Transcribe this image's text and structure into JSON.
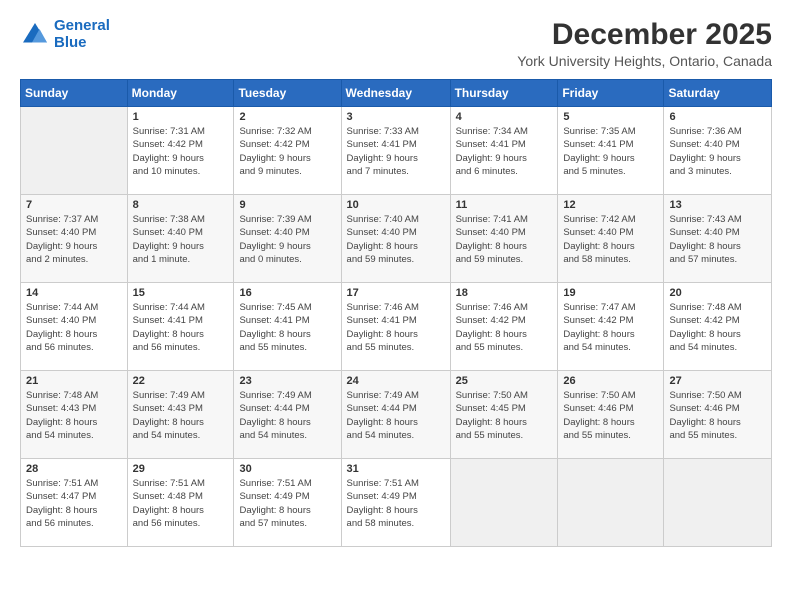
{
  "header": {
    "logo_line1": "General",
    "logo_line2": "Blue",
    "month": "December 2025",
    "location": "York University Heights, Ontario, Canada"
  },
  "weekdays": [
    "Sunday",
    "Monday",
    "Tuesday",
    "Wednesday",
    "Thursday",
    "Friday",
    "Saturday"
  ],
  "weeks": [
    [
      {
        "day": "",
        "info": ""
      },
      {
        "day": "1",
        "info": "Sunrise: 7:31 AM\nSunset: 4:42 PM\nDaylight: 9 hours\nand 10 minutes."
      },
      {
        "day": "2",
        "info": "Sunrise: 7:32 AM\nSunset: 4:42 PM\nDaylight: 9 hours\nand 9 minutes."
      },
      {
        "day": "3",
        "info": "Sunrise: 7:33 AM\nSunset: 4:41 PM\nDaylight: 9 hours\nand 7 minutes."
      },
      {
        "day": "4",
        "info": "Sunrise: 7:34 AM\nSunset: 4:41 PM\nDaylight: 9 hours\nand 6 minutes."
      },
      {
        "day": "5",
        "info": "Sunrise: 7:35 AM\nSunset: 4:41 PM\nDaylight: 9 hours\nand 5 minutes."
      },
      {
        "day": "6",
        "info": "Sunrise: 7:36 AM\nSunset: 4:40 PM\nDaylight: 9 hours\nand 3 minutes."
      }
    ],
    [
      {
        "day": "7",
        "info": "Sunrise: 7:37 AM\nSunset: 4:40 PM\nDaylight: 9 hours\nand 2 minutes."
      },
      {
        "day": "8",
        "info": "Sunrise: 7:38 AM\nSunset: 4:40 PM\nDaylight: 9 hours\nand 1 minute."
      },
      {
        "day": "9",
        "info": "Sunrise: 7:39 AM\nSunset: 4:40 PM\nDaylight: 9 hours\nand 0 minutes."
      },
      {
        "day": "10",
        "info": "Sunrise: 7:40 AM\nSunset: 4:40 PM\nDaylight: 8 hours\nand 59 minutes."
      },
      {
        "day": "11",
        "info": "Sunrise: 7:41 AM\nSunset: 4:40 PM\nDaylight: 8 hours\nand 59 minutes."
      },
      {
        "day": "12",
        "info": "Sunrise: 7:42 AM\nSunset: 4:40 PM\nDaylight: 8 hours\nand 58 minutes."
      },
      {
        "day": "13",
        "info": "Sunrise: 7:43 AM\nSunset: 4:40 PM\nDaylight: 8 hours\nand 57 minutes."
      }
    ],
    [
      {
        "day": "14",
        "info": "Sunrise: 7:44 AM\nSunset: 4:40 PM\nDaylight: 8 hours\nand 56 minutes."
      },
      {
        "day": "15",
        "info": "Sunrise: 7:44 AM\nSunset: 4:41 PM\nDaylight: 8 hours\nand 56 minutes."
      },
      {
        "day": "16",
        "info": "Sunrise: 7:45 AM\nSunset: 4:41 PM\nDaylight: 8 hours\nand 55 minutes."
      },
      {
        "day": "17",
        "info": "Sunrise: 7:46 AM\nSunset: 4:41 PM\nDaylight: 8 hours\nand 55 minutes."
      },
      {
        "day": "18",
        "info": "Sunrise: 7:46 AM\nSunset: 4:42 PM\nDaylight: 8 hours\nand 55 minutes."
      },
      {
        "day": "19",
        "info": "Sunrise: 7:47 AM\nSunset: 4:42 PM\nDaylight: 8 hours\nand 54 minutes."
      },
      {
        "day": "20",
        "info": "Sunrise: 7:48 AM\nSunset: 4:42 PM\nDaylight: 8 hours\nand 54 minutes."
      }
    ],
    [
      {
        "day": "21",
        "info": "Sunrise: 7:48 AM\nSunset: 4:43 PM\nDaylight: 8 hours\nand 54 minutes."
      },
      {
        "day": "22",
        "info": "Sunrise: 7:49 AM\nSunset: 4:43 PM\nDaylight: 8 hours\nand 54 minutes."
      },
      {
        "day": "23",
        "info": "Sunrise: 7:49 AM\nSunset: 4:44 PM\nDaylight: 8 hours\nand 54 minutes."
      },
      {
        "day": "24",
        "info": "Sunrise: 7:49 AM\nSunset: 4:44 PM\nDaylight: 8 hours\nand 54 minutes."
      },
      {
        "day": "25",
        "info": "Sunrise: 7:50 AM\nSunset: 4:45 PM\nDaylight: 8 hours\nand 55 minutes."
      },
      {
        "day": "26",
        "info": "Sunrise: 7:50 AM\nSunset: 4:46 PM\nDaylight: 8 hours\nand 55 minutes."
      },
      {
        "day": "27",
        "info": "Sunrise: 7:50 AM\nSunset: 4:46 PM\nDaylight: 8 hours\nand 55 minutes."
      }
    ],
    [
      {
        "day": "28",
        "info": "Sunrise: 7:51 AM\nSunset: 4:47 PM\nDaylight: 8 hours\nand 56 minutes."
      },
      {
        "day": "29",
        "info": "Sunrise: 7:51 AM\nSunset: 4:48 PM\nDaylight: 8 hours\nand 56 minutes."
      },
      {
        "day": "30",
        "info": "Sunrise: 7:51 AM\nSunset: 4:49 PM\nDaylight: 8 hours\nand 57 minutes."
      },
      {
        "day": "31",
        "info": "Sunrise: 7:51 AM\nSunset: 4:49 PM\nDaylight: 8 hours\nand 58 minutes."
      },
      {
        "day": "",
        "info": ""
      },
      {
        "day": "",
        "info": ""
      },
      {
        "day": "",
        "info": ""
      }
    ]
  ]
}
